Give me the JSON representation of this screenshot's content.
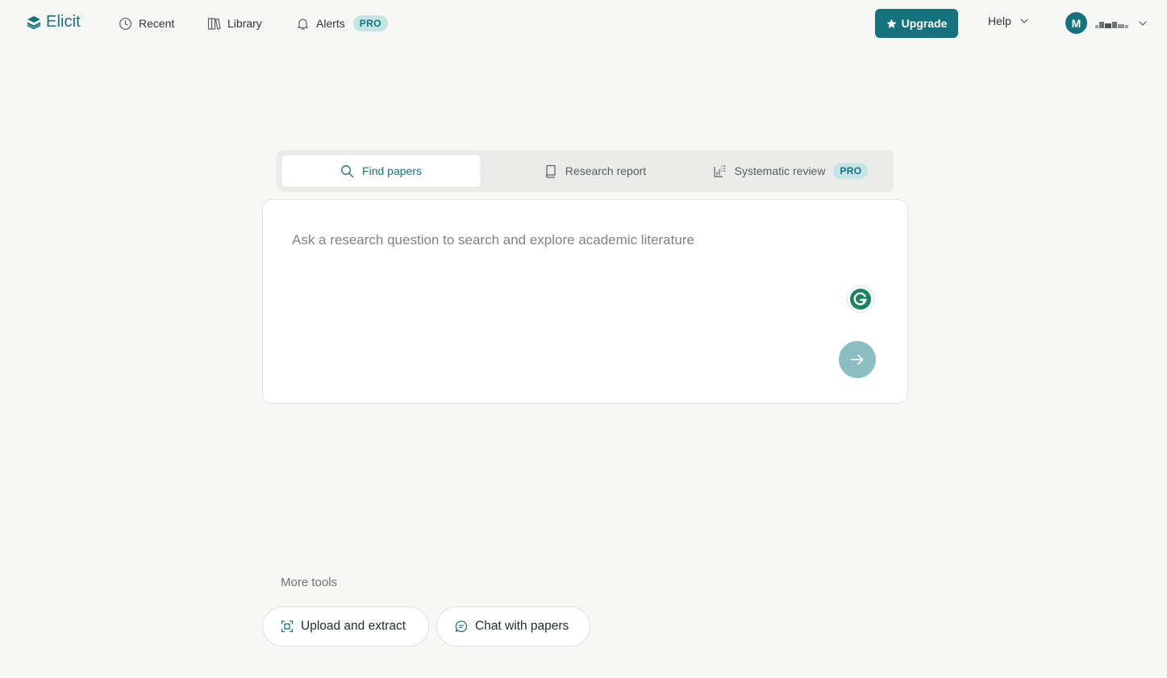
{
  "app": {
    "name": "Elicit"
  },
  "nav": {
    "recent": "Recent",
    "library": "Library",
    "alerts": "Alerts",
    "alerts_badge": "PRO",
    "upgrade": "Upgrade",
    "help": "Help",
    "avatar_initial": "M"
  },
  "modes": {
    "find_papers": "Find papers",
    "research_report": "Research report",
    "systematic_review": "Systematic review",
    "systematic_review_badge": "PRO",
    "active": "find_papers"
  },
  "search": {
    "placeholder": "Ask a research question to search and explore academic literature",
    "value": ""
  },
  "more_tools": {
    "label": "More tools",
    "upload_extract": "Upload and extract",
    "chat_with_papers": "Chat with papers"
  },
  "icons": {
    "logo": "elicit-logo-icon",
    "recent": "clock-icon",
    "library": "books-icon",
    "alerts": "bell-icon",
    "upgrade": "star-icon",
    "help": "chevron-down-icon",
    "account": "chevron-down-icon",
    "find_papers": "search-icon",
    "research_report": "book-icon",
    "systematic_review": "list-chart-icon",
    "grammarly": "grammarly-icon",
    "submit": "arrow-right-icon",
    "upload": "scan-icon",
    "chat": "chat-bubble-icon"
  },
  "colors": {
    "brand": "#14727d",
    "badge_bg": "#c4e4e6",
    "submit_disabled": "#8abec3",
    "background": "#f7f7f5"
  }
}
